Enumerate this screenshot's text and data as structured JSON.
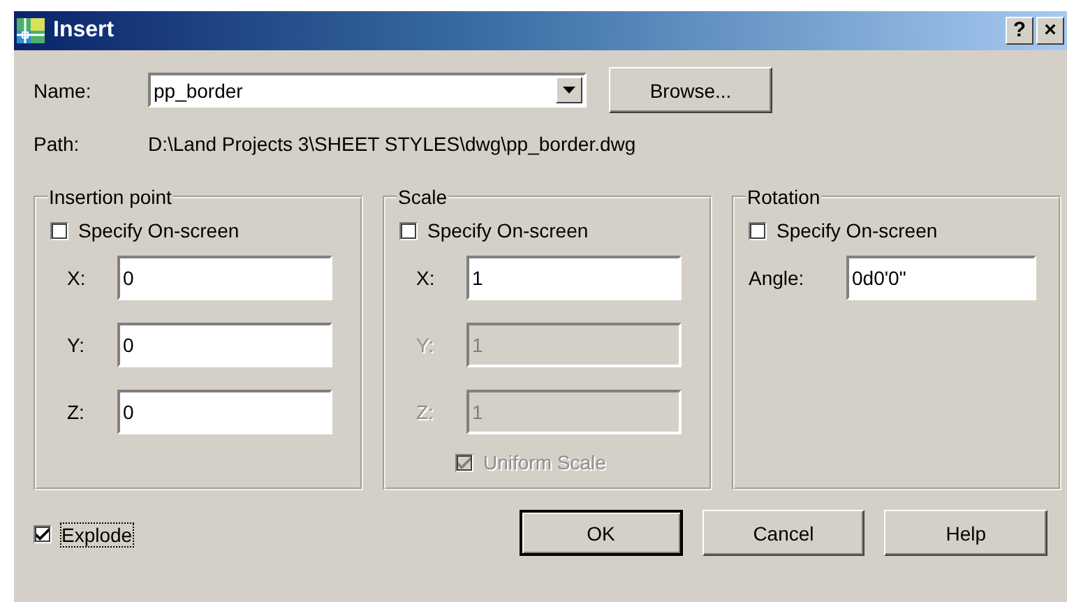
{
  "window": {
    "title": "Insert",
    "title_buttons": [
      "?",
      "×"
    ]
  },
  "name": {
    "label": "Name:",
    "value": "pp_border"
  },
  "browse": {
    "label": "Browse..."
  },
  "path": {
    "label": "Path:",
    "value": "D:\\Land Projects 3\\SHEET STYLES\\dwg\\pp_border.dwg"
  },
  "groups": [
    {
      "title": "Insertion point",
      "specify": {
        "label": "Specify On-screen",
        "checked": false
      },
      "fields": [
        {
          "kind": "axis",
          "label": "X:",
          "value": "0",
          "disabled": false
        },
        {
          "kind": "axis",
          "label": "Y:",
          "value": "0",
          "disabled": false
        },
        {
          "kind": "axis",
          "label": "Z:",
          "value": "0",
          "disabled": false
        }
      ]
    },
    {
      "title": "Scale",
      "specify": {
        "label": "Specify On-screen",
        "checked": false
      },
      "fields": [
        {
          "kind": "axis",
          "label": "X:",
          "value": "1",
          "disabled": false
        },
        {
          "kind": "axis",
          "label": "Y:",
          "value": "1",
          "disabled": true
        },
        {
          "kind": "axis",
          "label": "Z:",
          "value": "1",
          "disabled": true
        }
      ],
      "uniform": {
        "label": "Uniform Scale",
        "checked": true,
        "disabled": true
      }
    },
    {
      "title": "Rotation",
      "specify": {
        "label": "Specify On-screen",
        "checked": false
      },
      "fields": [
        {
          "kind": "angle",
          "label": "Angle:",
          "value": "0d0'0\"",
          "disabled": false
        }
      ]
    }
  ],
  "explode": {
    "label": "Explode",
    "checked": true
  },
  "buttons": [
    {
      "label": "OK",
      "default": true
    },
    {
      "label": "Cancel",
      "default": false
    },
    {
      "label": "Help",
      "default": false
    }
  ]
}
